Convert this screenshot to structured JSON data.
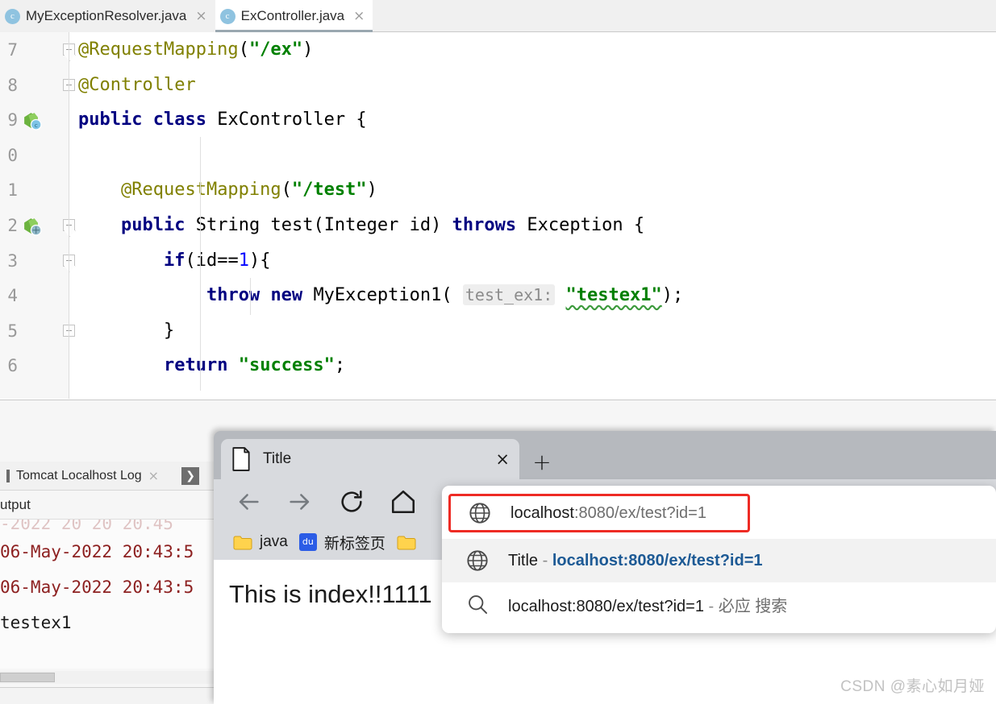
{
  "ide": {
    "tabs": [
      {
        "label": "MyExceptionResolver.java",
        "icon": "java-class-icon",
        "active": false,
        "close": "×"
      },
      {
        "label": "ExController.java",
        "icon": "java-class-icon",
        "active": true,
        "close": "×"
      }
    ],
    "editor": {
      "line_numbers": [
        "7",
        "8",
        "9",
        "0",
        "1",
        "2",
        "3",
        "4",
        "5",
        "6"
      ],
      "lines": [
        {
          "n": "7",
          "text": "@RequestMapping(\"/ex\")"
        },
        {
          "n": "8",
          "text": "@Controller"
        },
        {
          "n": "9",
          "text": "public class ExController {"
        },
        {
          "n": "0",
          "text": ""
        },
        {
          "n": "1",
          "text": "    @RequestMapping(\"/test\")"
        },
        {
          "n": "2",
          "text": "    public String test(Integer id) throws Exception {"
        },
        {
          "n": "3",
          "text": "        if(id==1){"
        },
        {
          "n": "4",
          "text": "            throw new MyException1( test_ex1: \"testex1\");"
        },
        {
          "n": "5",
          "text": "        }"
        },
        {
          "n": "6",
          "text": "        return \"success\";"
        }
      ],
      "tokens": {
        "anno_request_mapping": "@RequestMapping",
        "str_ex": "\"/ex\"",
        "str_test": "\"/test\"",
        "anno_controller": "@Controller",
        "kw_public": "public",
        "kw_class": "class",
        "ident_excontroller": "ExController",
        "brace_open": "{",
        "kw_string": "String",
        "ident_test": "test",
        "ident_integer": "Integer",
        "ident_id": "id",
        "kw_throws": "throws",
        "ident_exception": "Exception",
        "kw_if": "if",
        "expr_id_eq": "(id==",
        "num_one": "1",
        "paren_brace": "){",
        "kw_throw": "throw",
        "kw_new": "new",
        "ident_myexception1": "MyException1(",
        "hint_param": "test_ex1:",
        "str_testex1": "\"testex1\"",
        "close_paren_semi": ");",
        "brace_close": "}",
        "kw_return": "return",
        "str_success": "\"success\"",
        "semi": ";"
      }
    },
    "log": {
      "tab_label": "Tomcat Localhost Log",
      "tab_close": "×",
      "expand_icon": "❯",
      "subheader": "utput",
      "lines": [
        {
          "text": "-2022 20 20 20.45",
          "style": "cut"
        },
        {
          "text": "06-May-2022 20:43:5",
          "style": "red"
        },
        {
          "text": "06-May-2022 20:43:5",
          "style": "red"
        },
        {
          "text": "testex1",
          "style": "black"
        }
      ]
    }
  },
  "browser": {
    "tab": {
      "title": "Title",
      "icon": "page-icon",
      "close": "×"
    },
    "new_tab_label": "+",
    "nav": {
      "back": "back-arrow-icon",
      "forward": "forward-arrow-icon",
      "reload": "reload-icon",
      "home": "home-icon"
    },
    "bookmarks": [
      {
        "label": "java",
        "icon": "folder-icon"
      },
      {
        "label": "新标签页",
        "icon": "baidu-icon"
      },
      {
        "label": "",
        "icon": "folder-icon"
      }
    ],
    "page_text": "This is index!!1111",
    "address_bar": {
      "value_prefix": "localhost",
      "value_suffix": ":8080/ex/test?id=1",
      "full_value": "localhost:8080/ex/test?id=1",
      "icon": "globe-icon",
      "highlight_color": "#ee2b24"
    },
    "suggestions": [
      {
        "icon": "globe-icon",
        "title": "Title",
        "dash": " - ",
        "url": "localhost:8080/ex/test?id=1",
        "selected": true
      },
      {
        "icon": "search-icon",
        "query": "localhost:8080/ex/test?id=1",
        "dash": " - ",
        "engine": "必应 搜索",
        "selected": false
      }
    ]
  },
  "watermark": "CSDN @素心如月娅"
}
